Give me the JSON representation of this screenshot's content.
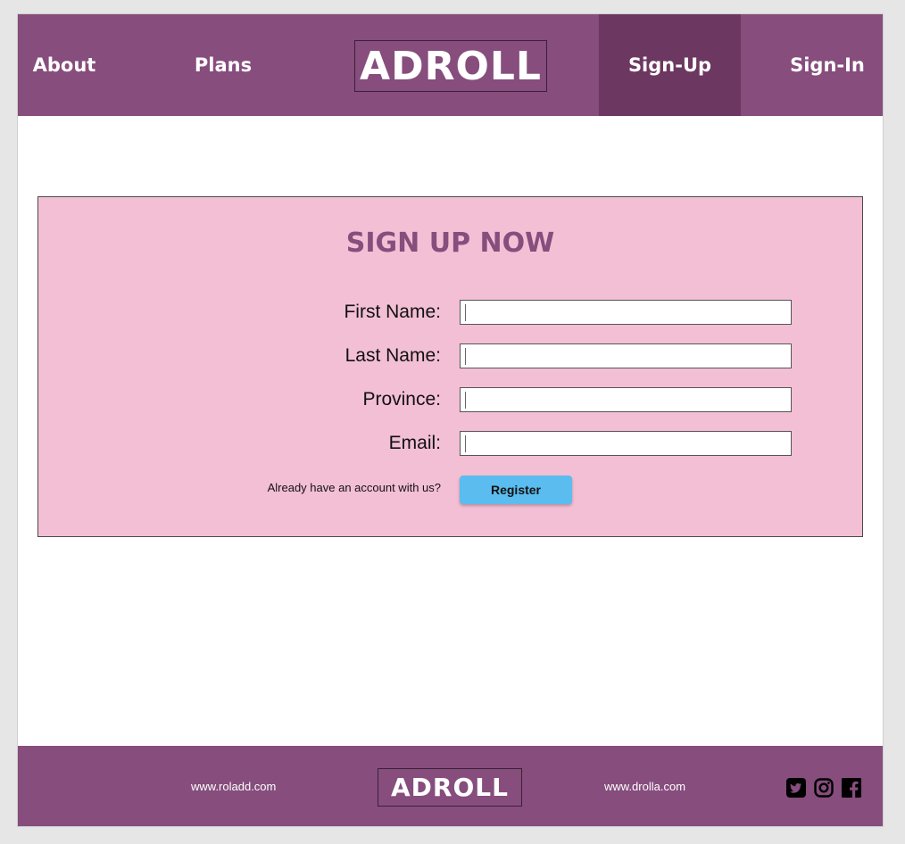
{
  "header": {
    "nav": {
      "about": "About",
      "plans": "Plans",
      "signup": "Sign-Up",
      "signin": "Sign-In"
    },
    "logo": "ADROLL"
  },
  "signup_form": {
    "title": "SIGN UP NOW",
    "fields": [
      {
        "label": "First Name:",
        "value": ""
      },
      {
        "label": "Last Name:",
        "value": ""
      },
      {
        "label": "Province:",
        "value": ""
      },
      {
        "label": "Email:",
        "value": ""
      }
    ],
    "account_prompt": "Already have an account with us?",
    "register_label": "Register"
  },
  "footer": {
    "link_left": "www.roladd.com",
    "logo": "ADROLL",
    "link_right": "www.drolla.com",
    "social_icons": [
      "twitter-icon",
      "instagram-icon",
      "facebook-icon"
    ]
  },
  "colors": {
    "brand_purple": "#864d7d",
    "active_nav": "#6c3760",
    "panel_pink": "#f3bfd5",
    "button_blue": "#5bbcef"
  }
}
